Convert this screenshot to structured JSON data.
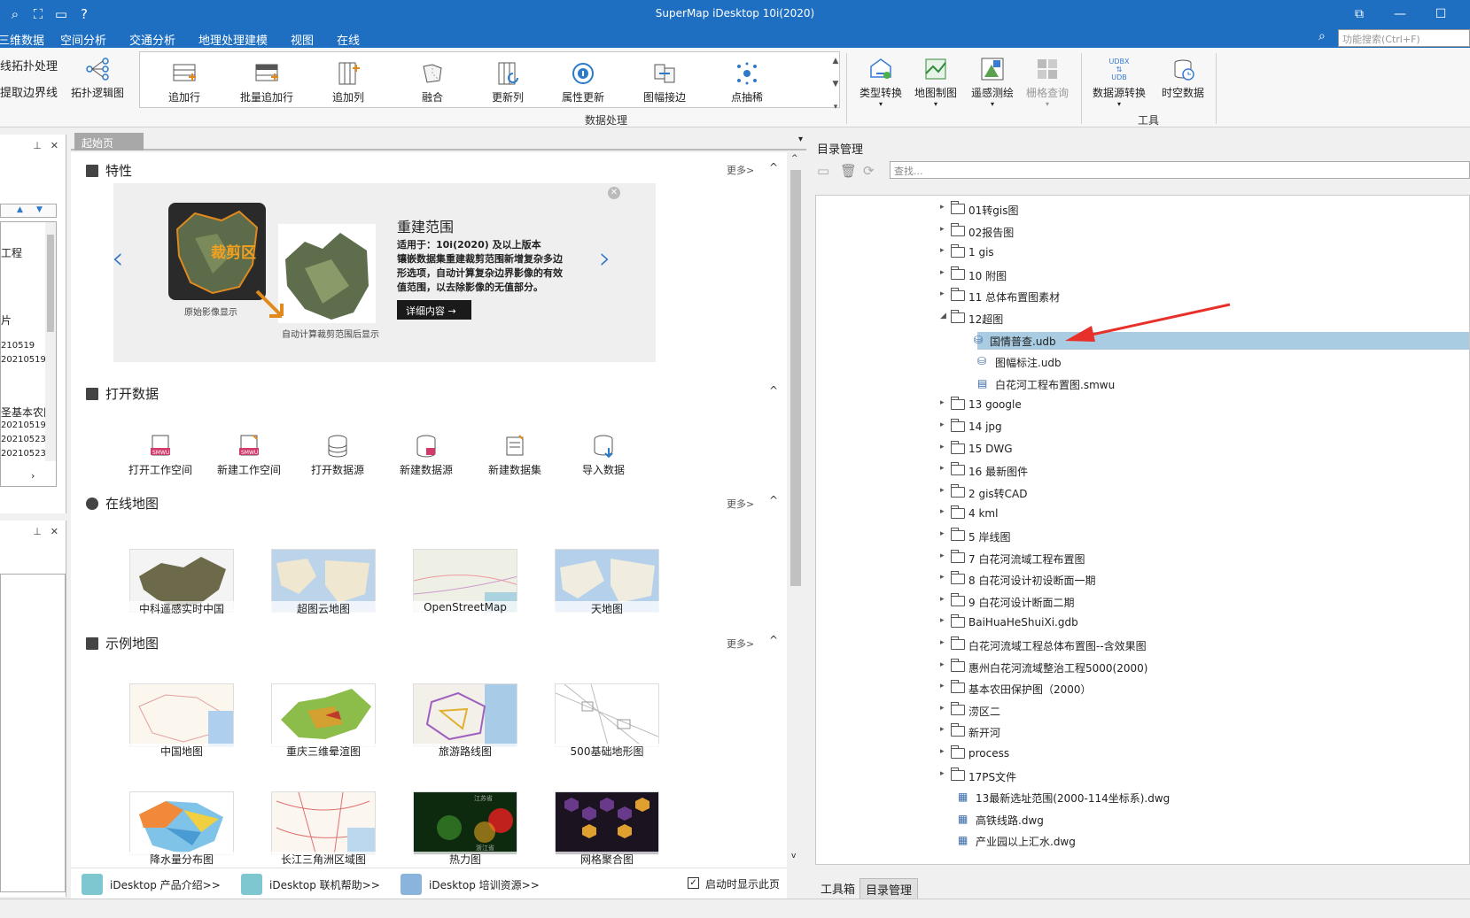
{
  "titlebar": {
    "title": "SuperMap iDesktop 10i(2020)"
  },
  "menu": {
    "items": [
      "三维数据",
      "空间分析",
      "交通分析",
      "地理处理建模",
      "视图",
      "在线"
    ],
    "search_placeholder": "功能搜索(Ctrl+F)"
  },
  "ribbon": {
    "left_items": [
      "线拓扑处理",
      "提取边界线",
      "拓扑逻辑图"
    ],
    "data_group": {
      "label": "数据处理",
      "buttons": [
        "追加行",
        "批量追加行",
        "追加列",
        "融合",
        "更新列",
        "属性更新",
        "图幅接边",
        "点抽稀"
      ]
    },
    "right_buttons": [
      "类型转换",
      "地图制图",
      "遥感测绘",
      "栅格查询",
      "数据源转换",
      "时空数据"
    ],
    "udbx_icon_text": [
      "UDBX",
      "UDB"
    ],
    "tools_label": "工具"
  },
  "left_panel": {
    "fragments": [
      "工程",
      "片",
      "210519",
      "20210519",
      "圣基本农田",
      "20210519",
      "20210523",
      "20210523"
    ]
  },
  "startpage": {
    "tab_label": "起始页",
    "features": {
      "title": "特性",
      "more": "更多>",
      "banner": {
        "clip_label": "裁剪区",
        "orig_caption": "原始影像显示",
        "auto_caption": "自动计算裁剪范围后显示",
        "heading": "重建范围",
        "body_lines": [
          "适用于：10i(2020) 及以上版本",
          "镶嵌数据集重建裁剪范围新增复杂多边",
          "形选项，自动计算复杂边界影像的有效",
          "值范围，以去除影像的无值部分。"
        ],
        "detail_btn": "详细内容 →"
      }
    },
    "open_data": {
      "title": "打开数据",
      "buttons": [
        "打开工作空间",
        "新建工作空间",
        "打开数据源",
        "新建数据源",
        "新建数据集",
        "导入数据"
      ],
      "smwu_badge": "SMWU"
    },
    "online_maps": {
      "title": "在线地图",
      "more": "更多>",
      "items": [
        "中科遥感实时中国",
        "超图云地图",
        "OpenStreetMap",
        "天地图"
      ]
    },
    "sample_maps": {
      "title": "示例地图",
      "more": "更多>",
      "items": [
        "中国地图",
        "重庆三维晕渲图",
        "旅游路线图",
        "500基础地形图",
        "降水量分布图",
        "长江三角洲区域图",
        "热力图",
        "网格聚合图"
      ],
      "heatmap_labels": [
        "江苏省",
        "浙江省"
      ]
    },
    "footer": {
      "links": [
        "iDesktop 产品介绍>>",
        "iDesktop 联机帮助>>",
        "iDesktop 培训资源>>"
      ],
      "show_on_start": "启动时显示此页"
    }
  },
  "catalog": {
    "title": "目录管理",
    "search_placeholder": "查找...",
    "nodes": [
      {
        "label": "01转gis图",
        "type": "folder",
        "expanded": false
      },
      {
        "label": "02报告图",
        "type": "folder",
        "expanded": false
      },
      {
        "label": "1 gis",
        "type": "folder",
        "expanded": false
      },
      {
        "label": "10 附图",
        "type": "folder",
        "expanded": false
      },
      {
        "label": "11 总体布置图素材",
        "type": "folder",
        "expanded": false
      },
      {
        "label": "12超图",
        "type": "folder",
        "expanded": true
      },
      {
        "label": "国情普查.udb",
        "type": "udb",
        "child": true,
        "selected": true
      },
      {
        "label": "图幅标注.udb",
        "type": "udb",
        "child": true
      },
      {
        "label": "白花河工程布置图.smwu",
        "type": "smwu",
        "child": true
      },
      {
        "label": "13 google",
        "type": "folder",
        "expanded": false
      },
      {
        "label": "14 jpg",
        "type": "folder",
        "expanded": false
      },
      {
        "label": "15 DWG",
        "type": "folder",
        "expanded": false
      },
      {
        "label": "16 最新图件",
        "type": "folder",
        "expanded": false
      },
      {
        "label": "2 gis转CAD",
        "type": "folder",
        "expanded": false
      },
      {
        "label": "4 kml",
        "type": "folder",
        "expanded": false
      },
      {
        "label": "5 岸线图",
        "type": "folder",
        "expanded": false
      },
      {
        "label": "7 白花河流域工程布置图",
        "type": "folder",
        "expanded": false
      },
      {
        "label": "8 白花河设计初设断面一期",
        "type": "folder",
        "expanded": false
      },
      {
        "label": "9 白花河设计断面二期",
        "type": "folder",
        "expanded": false
      },
      {
        "label": "BaiHuaHeShuiXi.gdb",
        "type": "folder",
        "expanded": false
      },
      {
        "label": "白花河流域工程总体布置图--含效果图",
        "type": "folder",
        "expanded": false
      },
      {
        "label": "惠州白花河流域整治工程5000(2000)",
        "type": "folder",
        "expanded": false
      },
      {
        "label": "基本农田保护图（2000）",
        "type": "folder",
        "expanded": false
      },
      {
        "label": "涝区二",
        "type": "folder",
        "expanded": false
      },
      {
        "label": "新开河",
        "type": "folder",
        "expanded": false
      },
      {
        "label": "process",
        "type": "folder",
        "expanded": false
      },
      {
        "label": "17PS文件",
        "type": "folder",
        "expanded": false
      },
      {
        "label": "13最新选址范围(2000-114坐标系).dwg",
        "type": "dwg"
      },
      {
        "label": "高铁线路.dwg",
        "type": "dwg"
      },
      {
        "label": "产业园以上汇水.dwg",
        "type": "dwg"
      }
    ],
    "bottom_tabs": [
      "工具箱",
      "目录管理"
    ]
  },
  "colors": {
    "titlebar": "#1e6fc2",
    "selection": "#a9cce3",
    "annotation_arrow": "#e8302a"
  }
}
